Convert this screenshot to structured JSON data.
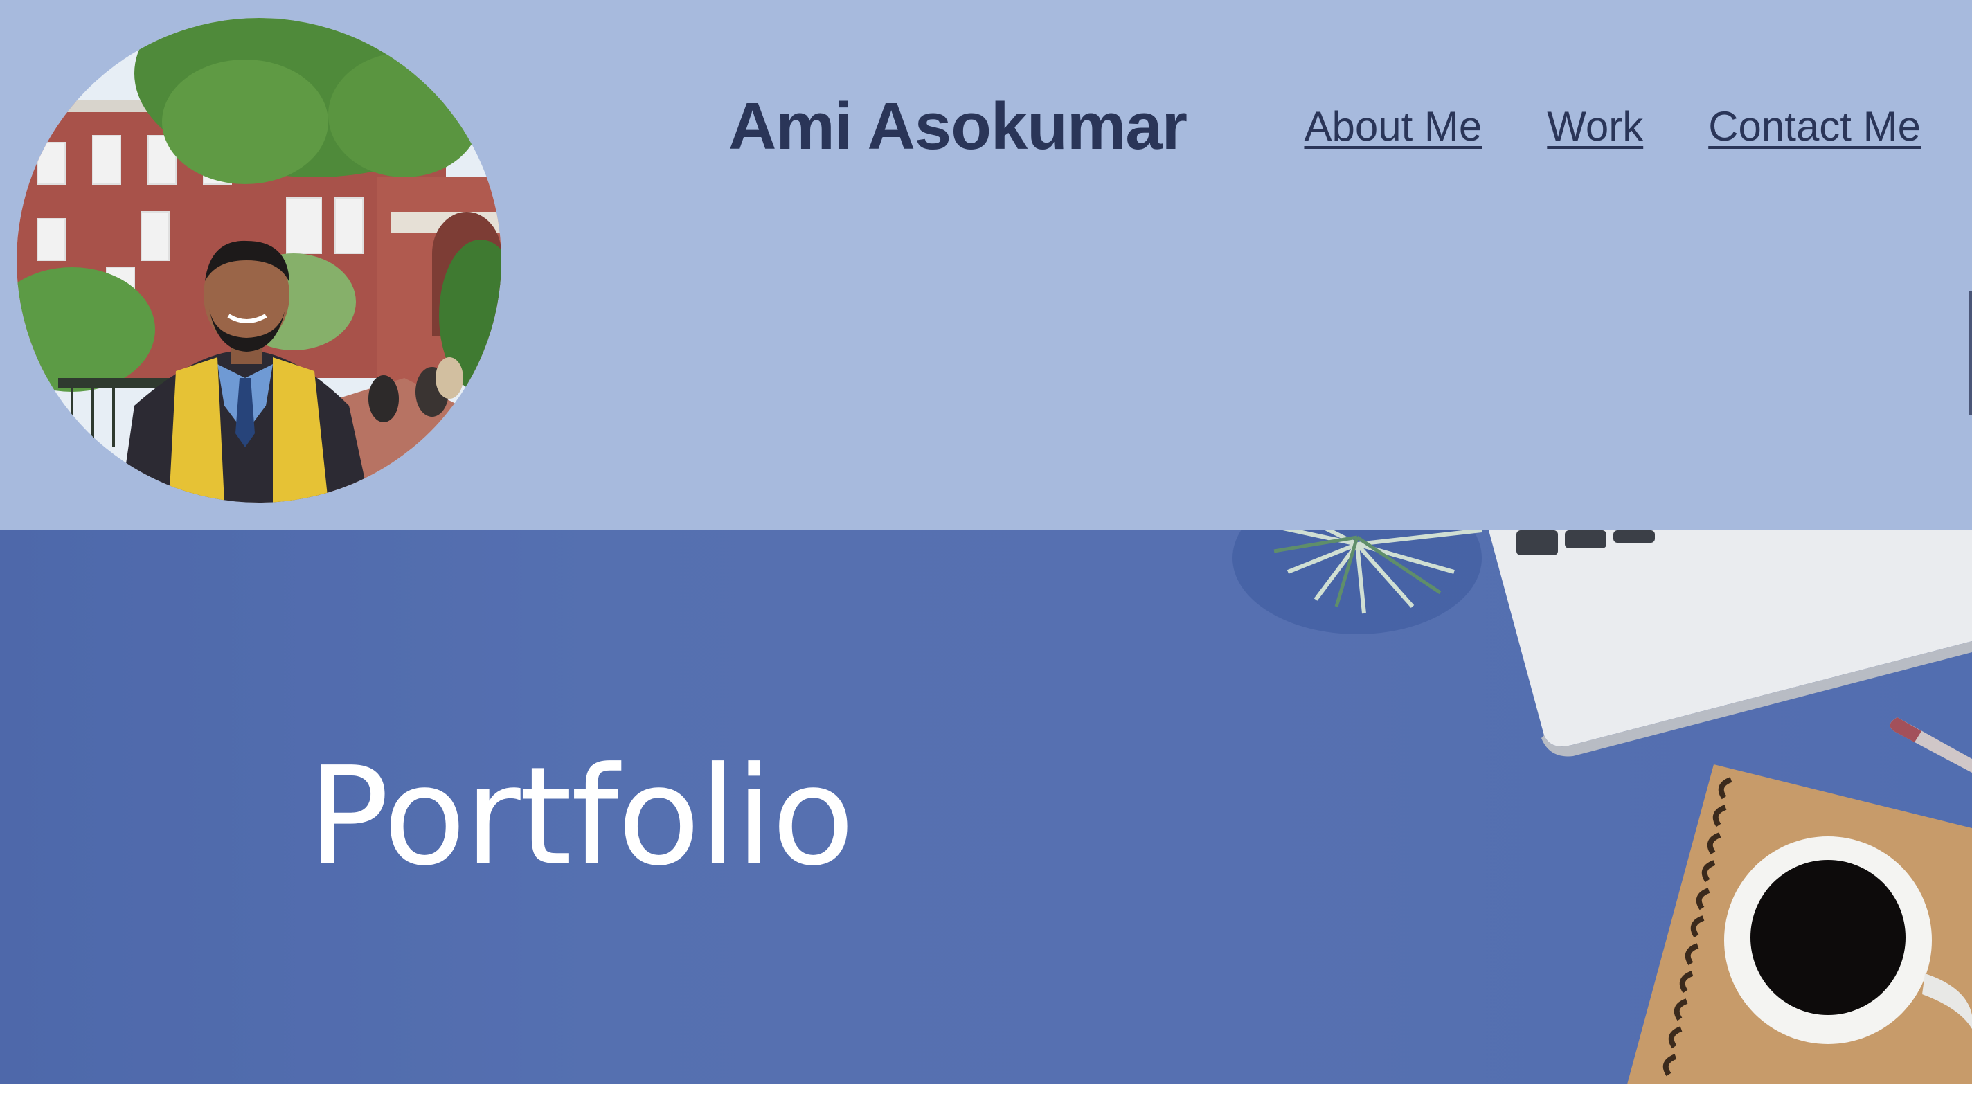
{
  "header": {
    "site_title": "Ami Asokumar",
    "nav": [
      {
        "label": "About Me"
      },
      {
        "label": "Work"
      },
      {
        "label": "Contact Me"
      }
    ],
    "avatar": "profile-photo"
  },
  "hero": {
    "title": "Portfolio",
    "background": "desk-with-laptop-plant-notebook-coffee"
  },
  "colors": {
    "header_bg": "#a7badd",
    "text_dark": "#2a3558",
    "hero_bg": "#5570b2",
    "hero_text": "#ffffff"
  }
}
